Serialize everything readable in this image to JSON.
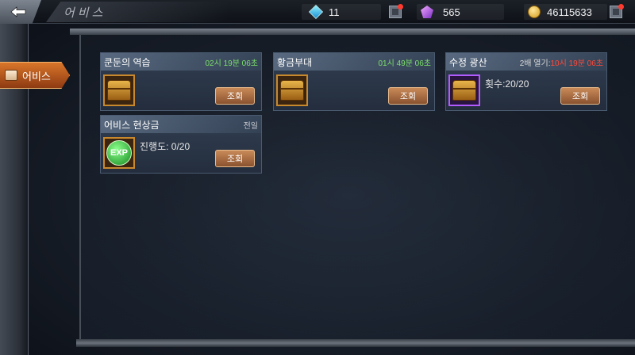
{
  "header": {
    "title": "어비스",
    "currencies": {
      "diamond": "11",
      "crystal": "565",
      "gold": "46115633"
    }
  },
  "sidebar": {
    "tab_label": "어비스"
  },
  "cards": [
    {
      "title": "쿤둔의 역습",
      "timer": "02시 19분 06초",
      "button": "조회"
    },
    {
      "title": "황금부대",
      "timer": "01시 49분 06초",
      "button": "조회"
    },
    {
      "title": "수정 광산",
      "timer_label": "2배 열기:",
      "timer": "10시 19분 06초",
      "count": "횟수:20/20",
      "button": "조회"
    },
    {
      "title": "어비스 현상금",
      "subtitle": "전일",
      "icon_text": "EXP",
      "progress": "진행도: 0/20",
      "button": "조회"
    }
  ],
  "colors": {
    "timer_green": "#7be06a",
    "timer_red": "#ff4a3a",
    "tab_orange": "#d9762a",
    "button_brown": "#a86a40"
  },
  "icons": [
    "back-arrow-icon",
    "diamond-icon",
    "crystal-icon",
    "gold-coin-icon",
    "plus-icon",
    "book-icon",
    "treasure-chest-icon",
    "exp-orb-icon"
  ]
}
